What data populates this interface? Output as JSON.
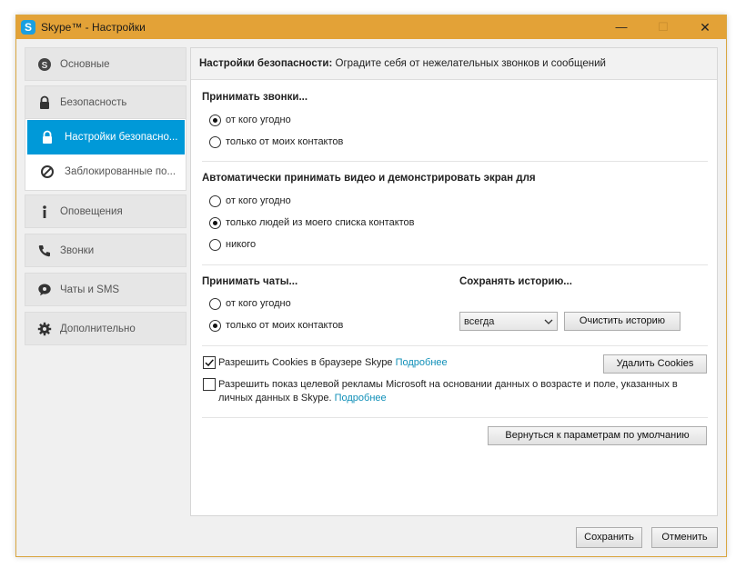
{
  "window": {
    "title": "Skype™ - Настройки",
    "app_icon_letter": "S",
    "min_glyph": "—",
    "max_glyph": "☐",
    "close_glyph": "✕"
  },
  "sidebar": {
    "items": [
      {
        "label": "Основные",
        "icon": "skype-icon"
      },
      {
        "label": "Безопасность",
        "icon": "lock-icon"
      },
      {
        "label": "Оповещения",
        "icon": "info-icon"
      },
      {
        "label": "Звонки",
        "icon": "phone-icon"
      },
      {
        "label": "Чаты и SMS",
        "icon": "chat-icon"
      },
      {
        "label": "Дополнительно",
        "icon": "gear-icon"
      }
    ],
    "sub_items": [
      {
        "label": "Настройки безопасно...",
        "icon": "lock-icon",
        "active": true
      },
      {
        "label": "Заблокированные по...",
        "icon": "block-icon",
        "active": false
      }
    ]
  },
  "header": {
    "title_bold": "Настройки безопасности:",
    "title_rest": " Оградите себя от нежелательных звонков и сообщений"
  },
  "calls": {
    "title": "Принимать звонки...",
    "options": [
      {
        "label": "от кого угодно",
        "selected": true
      },
      {
        "label": "только от моих контактов",
        "selected": false
      }
    ]
  },
  "video": {
    "title": "Автоматически принимать видео и демонстрировать экран для",
    "options": [
      {
        "label": "от кого угодно",
        "selected": false
      },
      {
        "label": "только людей из моего списка контактов",
        "selected": true
      },
      {
        "label": "никого",
        "selected": false
      }
    ]
  },
  "chats": {
    "title": "Принимать чаты...",
    "options": [
      {
        "label": "от кого угодно",
        "selected": false
      },
      {
        "label": "только от моих контактов",
        "selected": true
      }
    ]
  },
  "history": {
    "title": "Сохранять историю...",
    "selected_value": "всегда",
    "clear_button": "Очистить историю"
  },
  "cookies": {
    "label": "Разрешить Cookies в браузере Skype ",
    "link": "Подробнее",
    "checked": true,
    "delete_button": "Удалить Cookies"
  },
  "ads": {
    "line1": "Разрешить показ целевой рекламы Microsoft на основании данных о возрасте и поле, указанных в",
    "line2": "личных данных в Skype. ",
    "link": "Подробнее",
    "checked": false
  },
  "reset_button": "Вернуться к параметрам по умолчанию",
  "footer": {
    "save": "Сохранить",
    "cancel": "Отменить"
  }
}
